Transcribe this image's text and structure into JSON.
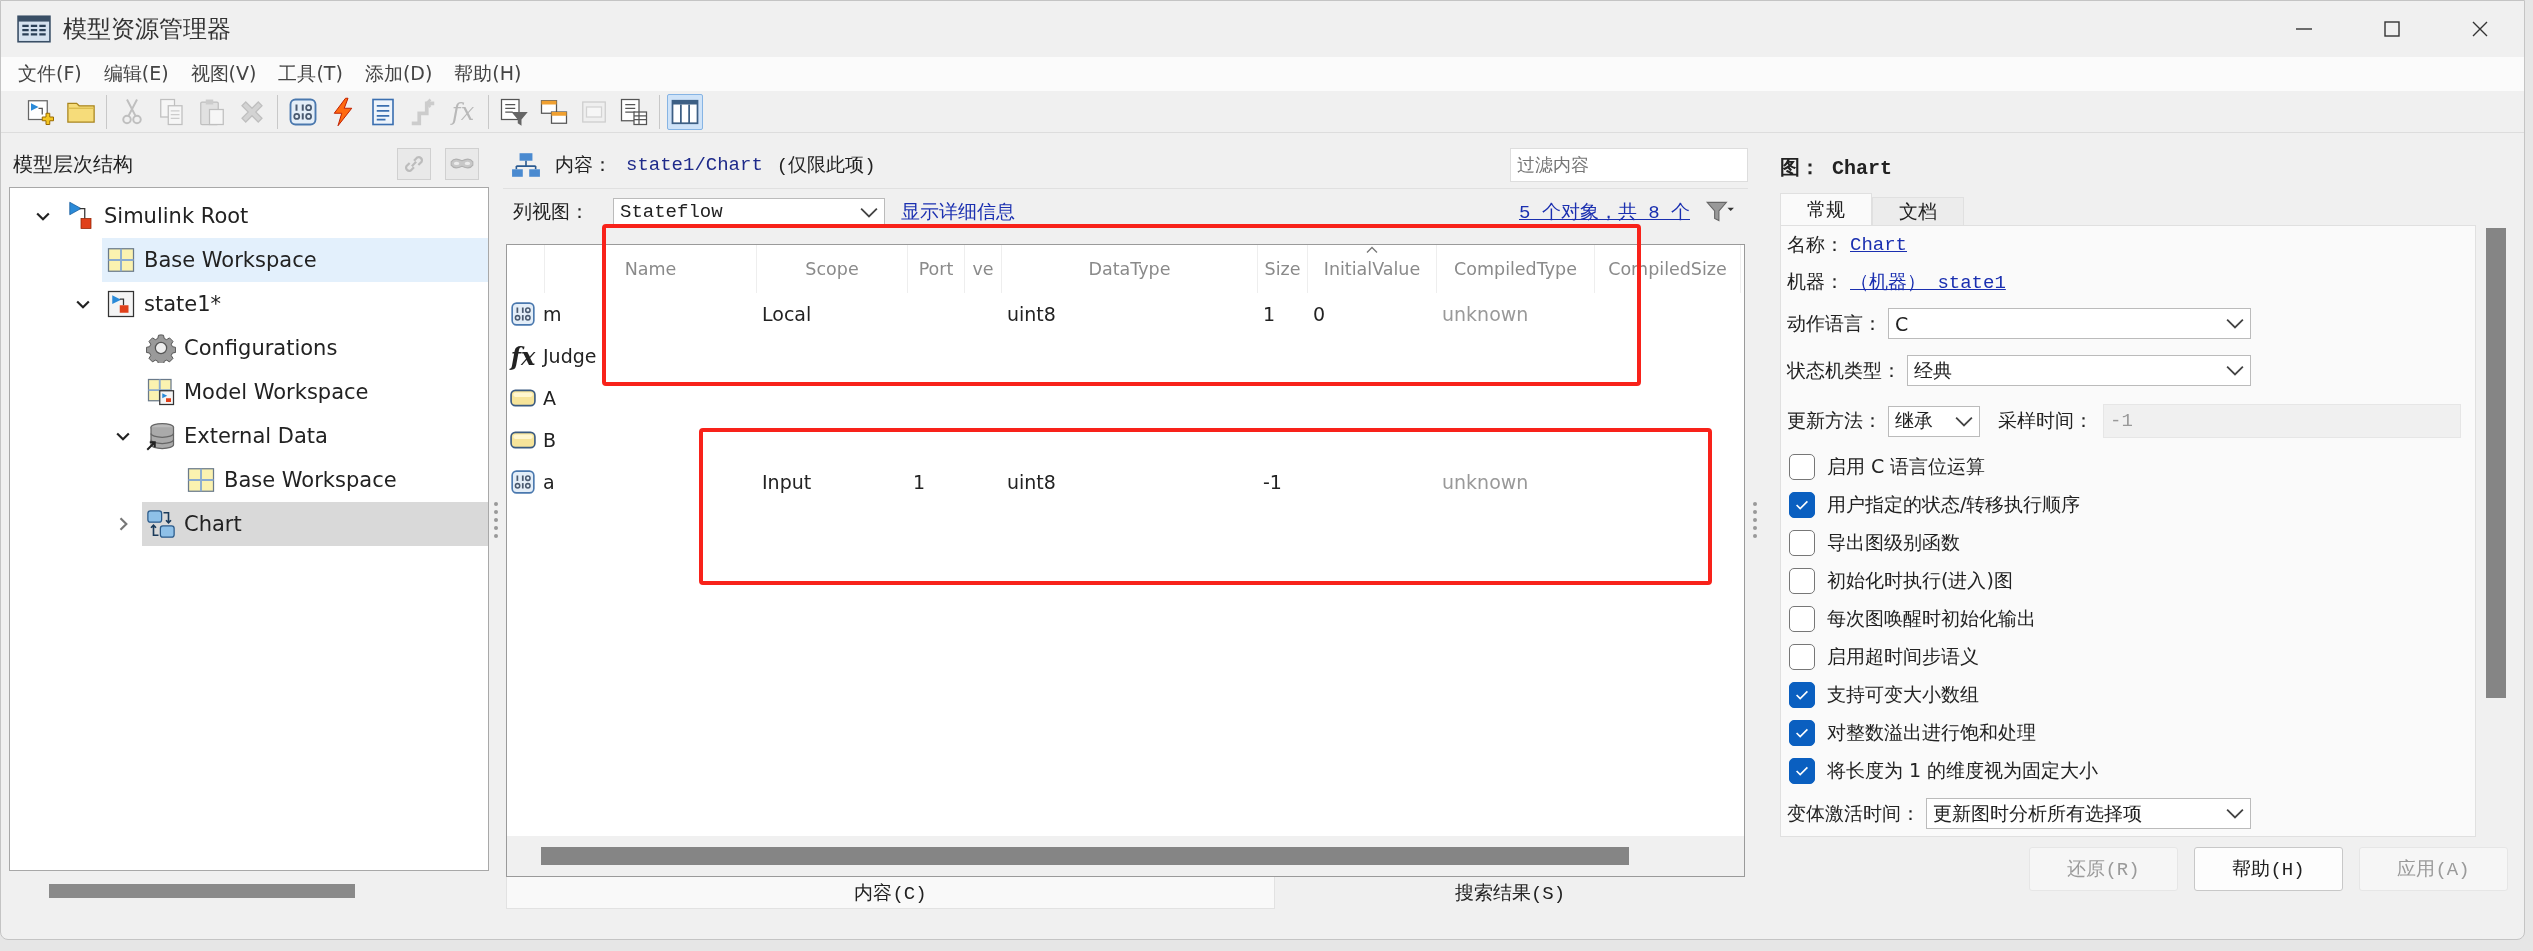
{
  "window": {
    "title": "模型资源管理器"
  },
  "menu": [
    "文件(F)",
    "编辑(E)",
    "视图(V)",
    "工具(T)",
    "添加(D)",
    "帮助(H)"
  ],
  "toolbar": [
    [
      {
        "kind": "new-model",
        "disabled": false,
        "pressed": false
      },
      {
        "kind": "open",
        "disabled": false,
        "pressed": false
      }
    ],
    [
      {
        "kind": "cut",
        "disabled": true,
        "pressed": false
      },
      {
        "kind": "copy",
        "disabled": true,
        "pressed": false
      },
      {
        "kind": "paste",
        "disabled": true,
        "pressed": false
      },
      {
        "kind": "delete",
        "disabled": true,
        "pressed": false
      }
    ],
    [
      {
        "kind": "data",
        "disabled": false,
        "pressed": false
      },
      {
        "kind": "event",
        "disabled": false,
        "pressed": false
      },
      {
        "kind": "message",
        "disabled": false,
        "pressed": false
      },
      {
        "kind": "step",
        "disabled": true,
        "pressed": false
      },
      {
        "kind": "function",
        "glyph": "fx",
        "disabled": true,
        "pressed": false
      }
    ],
    [
      {
        "kind": "filter",
        "disabled": false,
        "pressed": false
      },
      {
        "kind": "link-table",
        "disabled": false,
        "pressed": false
      },
      {
        "kind": "frame",
        "disabled": true,
        "pressed": false
      },
      {
        "kind": "doc-table",
        "disabled": false,
        "pressed": false
      }
    ],
    [
      {
        "kind": "columns",
        "disabled": false,
        "pressed": true
      }
    ]
  ],
  "hierarchy": {
    "title": "模型层次结构",
    "buttons": [
      {
        "kind": "link",
        "disabled": true
      },
      {
        "kind": "unlink",
        "disabled": true
      }
    ],
    "tree": [
      {
        "label": "Simulink Root",
        "kind": "root",
        "expanded": true,
        "selected": false,
        "highlighted": false,
        "children": [
          {
            "label": "Base Workspace",
            "kind": "workspace",
            "selected": false,
            "highlighted": true
          },
          {
            "label": "state1*",
            "kind": "model",
            "expanded": true,
            "selected": false,
            "highlighted": false,
            "children": [
              {
                "label": "Configurations",
                "kind": "config",
                "selected": false,
                "highlighted": false
              },
              {
                "label": "Model Workspace",
                "kind": "model-workspace",
                "selected": false,
                "highlighted": false
              },
              {
                "label": "External Data",
                "kind": "external-data",
                "expanded": true,
                "selected": false,
                "highlighted": false,
                "children": [
                  {
                    "label": "Base Workspace",
                    "kind": "workspace",
                    "selected": false,
                    "highlighted": false
                  }
                ]
              },
              {
                "label": "Chart",
                "kind": "chart",
                "expanded": false,
                "selected": true,
                "highlighted": false
              }
            ]
          }
        ]
      }
    ]
  },
  "contents": {
    "label": "内容：",
    "path": "state1/Chart",
    "scope": "(仅限此项)",
    "filter_placeholder": "过滤内容",
    "view_label": "列视图：",
    "view_value": "Stateflow",
    "details_link": "显示详细信息",
    "count_link": "5 个对象，共 8 个",
    "table": {
      "columns": [
        {
          "label": "Name",
          "sorted": false
        },
        {
          "label": "Scope",
          "sorted": false
        },
        {
          "label": "Port",
          "sorted": false
        },
        {
          "label": "ve",
          "sorted": false
        },
        {
          "label": "DataType",
          "sorted": false
        },
        {
          "label": "Size",
          "sorted": false
        },
        {
          "label": "InitialValue",
          "sorted": true
        },
        {
          "label": "CompiledType",
          "sorted": false
        },
        {
          "label": "CompiledSize",
          "sorted": false
        }
      ],
      "rows": [
        {
          "kind": "data",
          "name": "m",
          "scope": "Local",
          "data_type": "uint8",
          "size": "1",
          "initial_value": "0",
          "compiled_type": "unknown"
        },
        {
          "kind": "function",
          "icon_text": "fx",
          "name": "Judge"
        },
        {
          "kind": "state",
          "name": "A"
        },
        {
          "kind": "state",
          "name": "B"
        },
        {
          "kind": "data",
          "name": "a",
          "scope": "Input",
          "port": "1",
          "data_type": "uint8",
          "size": "-1",
          "compiled_type": "unknown"
        }
      ]
    },
    "tabs": [
      {
        "label": "内容(C)",
        "selected": true
      },
      {
        "label": "搜索结果(S)",
        "selected": false
      }
    ]
  },
  "properties": {
    "title": "图： Chart",
    "tabs": [
      {
        "label": "常规",
        "selected": true
      },
      {
        "label": "文档",
        "selected": false
      }
    ],
    "settings": [
      {
        "kind": "link",
        "label": "名称：",
        "value": "Chart"
      },
      {
        "kind": "link",
        "label": "机器：",
        "value": "（机器） state1"
      },
      {
        "kind": "dropdown",
        "label": "动作语言：",
        "value": "C"
      },
      {
        "kind": "dropdown",
        "label": "状态机类型：",
        "value": "经典"
      },
      {
        "kind": "update",
        "label": "更新方法：",
        "value": "继承",
        "sample_label": "采样时间：",
        "sample_value": "-1",
        "sample_disabled": true
      },
      {
        "kind": "checkbox",
        "label": "启用 C 语言位运算",
        "checked": false
      },
      {
        "kind": "checkbox",
        "label": "用户指定的状态/转移执行顺序",
        "checked": true
      },
      {
        "kind": "checkbox",
        "label": "导出图级别函数",
        "checked": false
      },
      {
        "kind": "checkbox",
        "label": "初始化时执行(进入)图",
        "checked": false
      },
      {
        "kind": "checkbox",
        "label": "每次图唤醒时初始化输出",
        "checked": false
      },
      {
        "kind": "checkbox",
        "label": "启用超时间步语义",
        "checked": false
      },
      {
        "kind": "checkbox",
        "label": "支持可变大小数组",
        "checked": true
      },
      {
        "kind": "checkbox",
        "label": "对整数溢出进行饱和处理",
        "checked": true
      },
      {
        "kind": "checkbox",
        "label": "将长度为 1 的维度视为固定大小",
        "checked": true
      },
      {
        "kind": "dropdown",
        "label": "变体激活时间：",
        "value": "更新图时分析所有选择项"
      }
    ],
    "buttons": [
      {
        "label": "还原(R)",
        "disabled": true
      },
      {
        "label": "帮助(H)",
        "disabled": false
      },
      {
        "label": "应用(A)",
        "disabled": true
      }
    ]
  },
  "annotations": [
    {
      "kind": "outline"
    },
    {
      "kind": "outline"
    }
  ]
}
